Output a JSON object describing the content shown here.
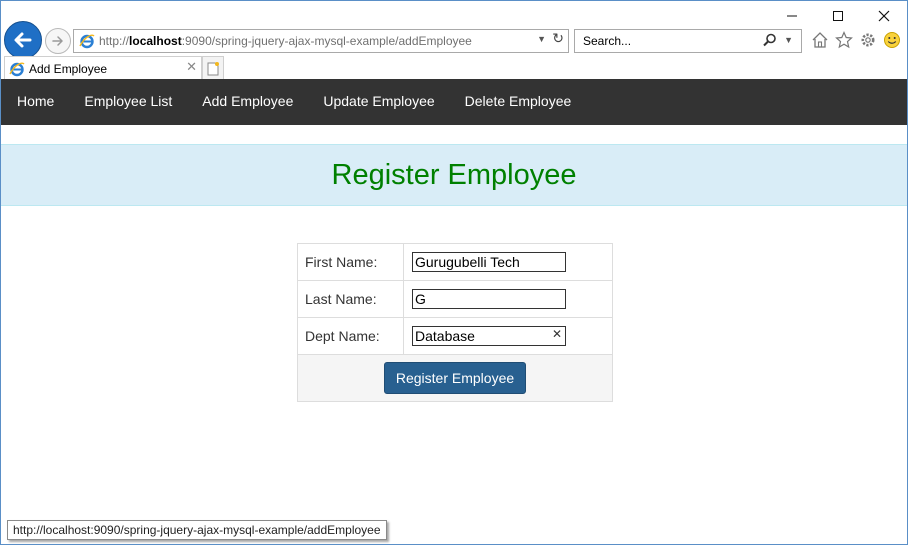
{
  "browser": {
    "address": {
      "prefix": "http://",
      "host": "localhost",
      "path": ":9090/spring-jquery-ajax-mysql-example/addEmployee"
    },
    "search_placeholder": "Search...",
    "tab_title": "Add Employee",
    "window_buttons": {
      "minimize": "—",
      "maximize": "☐",
      "close": "✕"
    },
    "status_url": "http://localhost:9090/spring-jquery-ajax-mysql-example/addEmployee"
  },
  "navbar": {
    "items": [
      {
        "label": "Home"
      },
      {
        "label": "Employee List"
      },
      {
        "label": "Add Employee"
      },
      {
        "label": "Update Employee"
      },
      {
        "label": "Delete Employee"
      }
    ]
  },
  "header": {
    "title": "Register Employee"
  },
  "form": {
    "first_name": {
      "label": "First Name:",
      "value": "Gurugubelli Tech"
    },
    "last_name": {
      "label": "Last Name:",
      "value": "G"
    },
    "dept_name": {
      "label": "Dept Name:",
      "value": "Database"
    },
    "submit_label": "Register Employee"
  },
  "colors": {
    "navbar": "#333333",
    "header_bg": "#d9edf7",
    "title": "#008000",
    "button": "#286090"
  }
}
